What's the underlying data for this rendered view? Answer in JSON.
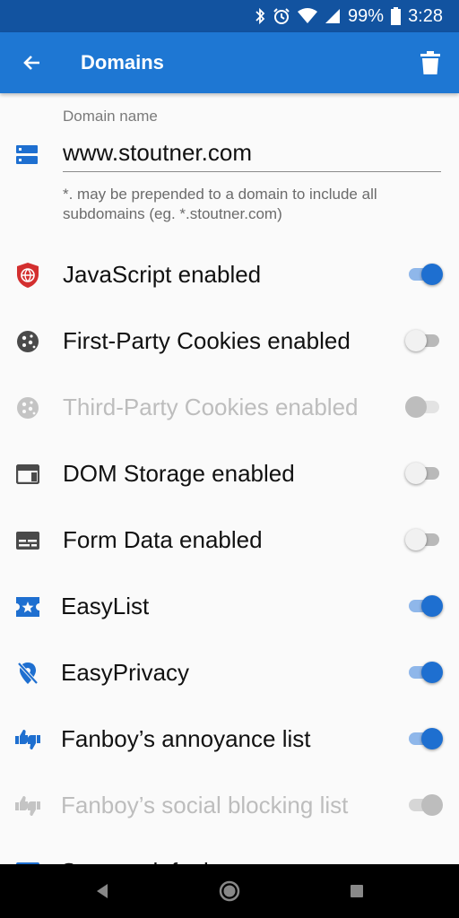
{
  "status_bar": {
    "battery": "99%",
    "time": "3:28"
  },
  "app_bar": {
    "title": "Domains"
  },
  "domain": {
    "label": "Domain name",
    "value": "www.stoutner.com",
    "hint": "*. may be prepended to a domain to include all subdomains (eg. *.stoutner.com)"
  },
  "settings": [
    {
      "label": "JavaScript enabled",
      "icon": "javascript-shield-icon",
      "enabled": true,
      "disabled": false
    },
    {
      "label": "First-Party Cookies enabled",
      "icon": "cookie-icon",
      "enabled": false,
      "disabled": false
    },
    {
      "label": "Third-Party Cookies enabled",
      "icon": "cookie-icon",
      "enabled": false,
      "disabled": true
    },
    {
      "label": "DOM Storage enabled",
      "icon": "web-storage-icon",
      "enabled": false,
      "disabled": false
    },
    {
      "label": "Form Data enabled",
      "icon": "form-data-icon",
      "enabled": false,
      "disabled": false
    },
    {
      "label": "EasyList",
      "icon": "easylist-icon",
      "enabled": true,
      "disabled": false
    },
    {
      "label": "EasyPrivacy",
      "icon": "easyprivacy-icon",
      "enabled": true,
      "disabled": false
    },
    {
      "label": "Fanboy’s annoyance list",
      "icon": "thumbs-icon",
      "enabled": true,
      "disabled": false
    },
    {
      "label": "Fanboy’s social blocking list",
      "icon": "thumbs-icon",
      "enabled": true,
      "disabled": true
    }
  ],
  "partial_row_label": "System default",
  "colors": {
    "primary": "#1e77d3",
    "status": "#1253a0",
    "accent": "#1e6fd0",
    "disabled": "#bdbdbd"
  }
}
